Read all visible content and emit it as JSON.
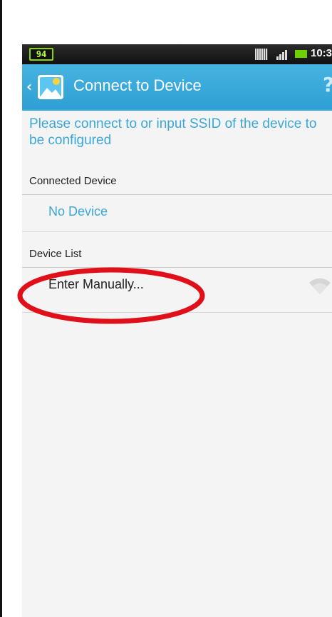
{
  "statusbar": {
    "badge": "94",
    "time": "10:3"
  },
  "actionbar": {
    "title": "Connect to Device",
    "help": "?"
  },
  "instructions": "Please connect to or input SSID of the device to be configured",
  "connected_device": {
    "header": "Connected Device",
    "value": "No Device"
  },
  "device_list": {
    "header": "Device List",
    "items": [
      {
        "label": "Enter Manually...",
        "icon": "wifi-icon"
      }
    ]
  },
  "colors": {
    "accent": "#38a9dc",
    "actionbar": "#3aaadb",
    "highlight": "#e0101a"
  }
}
